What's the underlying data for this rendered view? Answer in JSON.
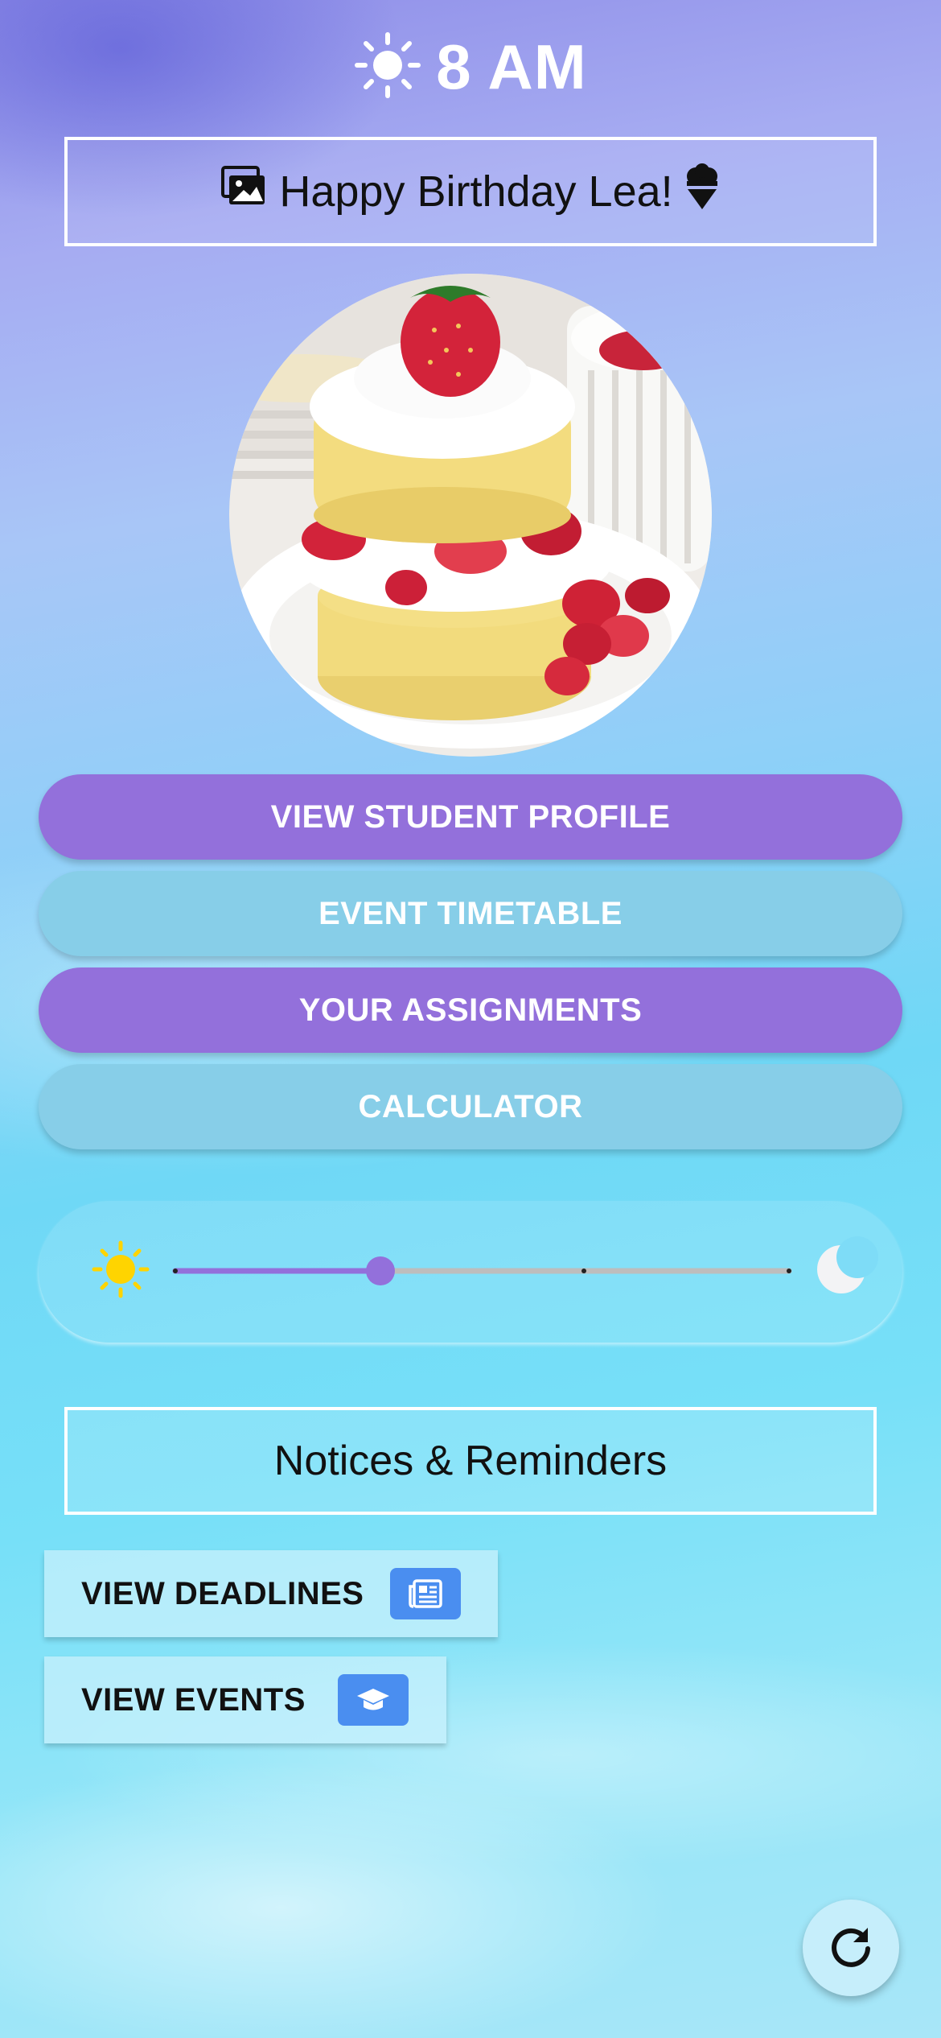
{
  "header": {
    "time": "8 AM",
    "weather_icon": "sun-icon"
  },
  "banner": {
    "text": "Happy Birthday Lea!",
    "left_icon": "images-icon",
    "right_icon": "ice-cream-icon"
  },
  "image": {
    "subject": "strawberry-shortcake-photo"
  },
  "menu": {
    "items": [
      {
        "label": "VIEW STUDENT PROFILE",
        "color": "#9370db"
      },
      {
        "label": "EVENT TIMETABLE",
        "color": "#87cee8"
      },
      {
        "label": "YOUR ASSIGNMENTS",
        "color": "#9370db"
      },
      {
        "label": "CALCULATOR",
        "color": "#87cee8"
      }
    ]
  },
  "theme_slider": {
    "left_icon": "sun-icon",
    "right_icon": "moon-icon",
    "value_fraction": 0.33,
    "steps": 3
  },
  "notices": {
    "title": "Notices & Reminders"
  },
  "actions": {
    "deadlines_label": "VIEW DEADLINES",
    "deadlines_icon": "newspaper-icon",
    "events_label": "VIEW EVENTS",
    "events_icon": "graduation-cap-icon"
  },
  "fab": {
    "icon": "refresh-icon"
  }
}
